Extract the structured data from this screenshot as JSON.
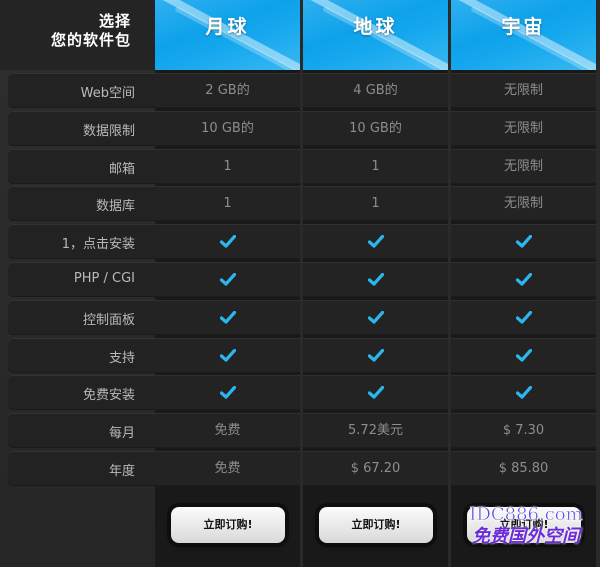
{
  "corner": {
    "line1": "选择",
    "line2": "您的软件包"
  },
  "plans": [
    {
      "name": "月球",
      "button": "立即订购!"
    },
    {
      "name": "地球",
      "button": "立即订购!"
    },
    {
      "name": "宇宙",
      "button": "立即订购!"
    }
  ],
  "rows": [
    {
      "label": "Web空间",
      "values": [
        "2 GB的",
        "4 GB的",
        "无限制"
      ]
    },
    {
      "label": "数据限制",
      "values": [
        "10 GB的",
        "10 GB的",
        "无限制"
      ]
    },
    {
      "label": "邮箱",
      "values": [
        "1",
        "1",
        "无限制"
      ]
    },
    {
      "label": "数据库",
      "values": [
        "1",
        "1",
        "无限制"
      ]
    },
    {
      "label": "1，点击安装",
      "values": [
        "check",
        "check",
        "check"
      ]
    },
    {
      "label": "PHP / CGI",
      "values": [
        "check",
        "check",
        "check"
      ]
    },
    {
      "label": "控制面板",
      "values": [
        "check",
        "check",
        "check"
      ]
    },
    {
      "label": "支持",
      "values": [
        "check",
        "check",
        "check"
      ]
    },
    {
      "label": "免费安装",
      "values": [
        "check",
        "check",
        "check"
      ]
    },
    {
      "label": "每月",
      "values": [
        "免费",
        "5.72美元",
        "$ 7.30"
      ]
    },
    {
      "label": "年度",
      "values": [
        "免费",
        "$ 67.20",
        "$ 85.80"
      ]
    }
  ],
  "watermark": {
    "line1": "IDC886.com",
    "line2": "免费国外空间"
  },
  "colors": {
    "accent": "#14a6ee",
    "check": "#2bb6ec",
    "cell_text": "#8d8d8d"
  }
}
